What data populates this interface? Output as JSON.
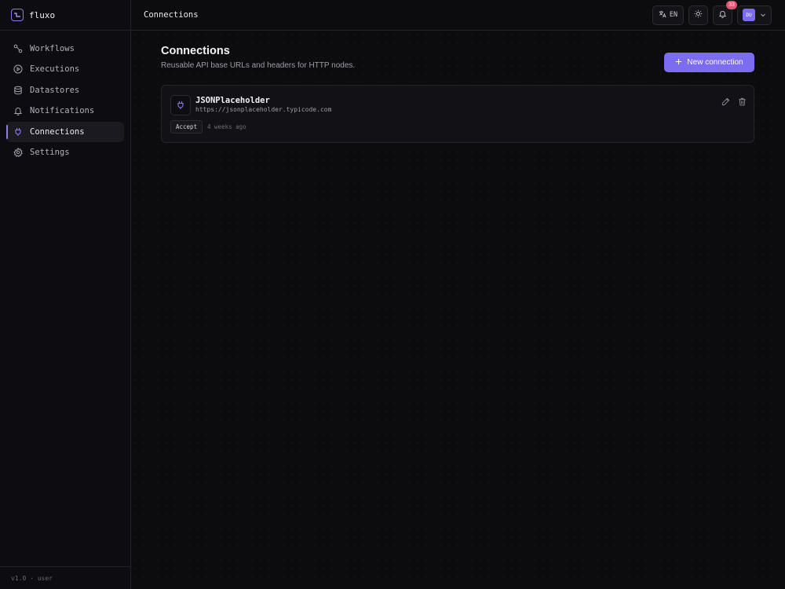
{
  "brand": {
    "name": "fluxo"
  },
  "sidebar": {
    "items": [
      {
        "label": "Workflows",
        "icon": "workflow-icon",
        "active": false
      },
      {
        "label": "Executions",
        "icon": "play-circle-icon",
        "active": false
      },
      {
        "label": "Datastores",
        "icon": "database-icon",
        "active": false
      },
      {
        "label": "Notifications",
        "icon": "bell-icon",
        "active": false
      },
      {
        "label": "Connections",
        "icon": "plug-icon",
        "active": true
      },
      {
        "label": "Settings",
        "icon": "gear-icon",
        "active": false
      }
    ],
    "footer": "v1.0 · user"
  },
  "topbar": {
    "title": "Connections",
    "language": "EN",
    "notification_count": "33",
    "avatar_initials": "DU"
  },
  "page": {
    "title": "Connections",
    "subtitle": "Reusable API base URLs and headers for HTTP nodes.",
    "new_button_label": "New connection"
  },
  "connections": [
    {
      "name": "JSONPlaceholder",
      "url": "https://jsonplaceholder.typicode.com",
      "tag": "Accept",
      "updated": "4 weeks ago"
    }
  ],
  "colors": {
    "accent": "#7c6cf0",
    "badge": "#e0556b",
    "background": "#0c0b0e"
  }
}
